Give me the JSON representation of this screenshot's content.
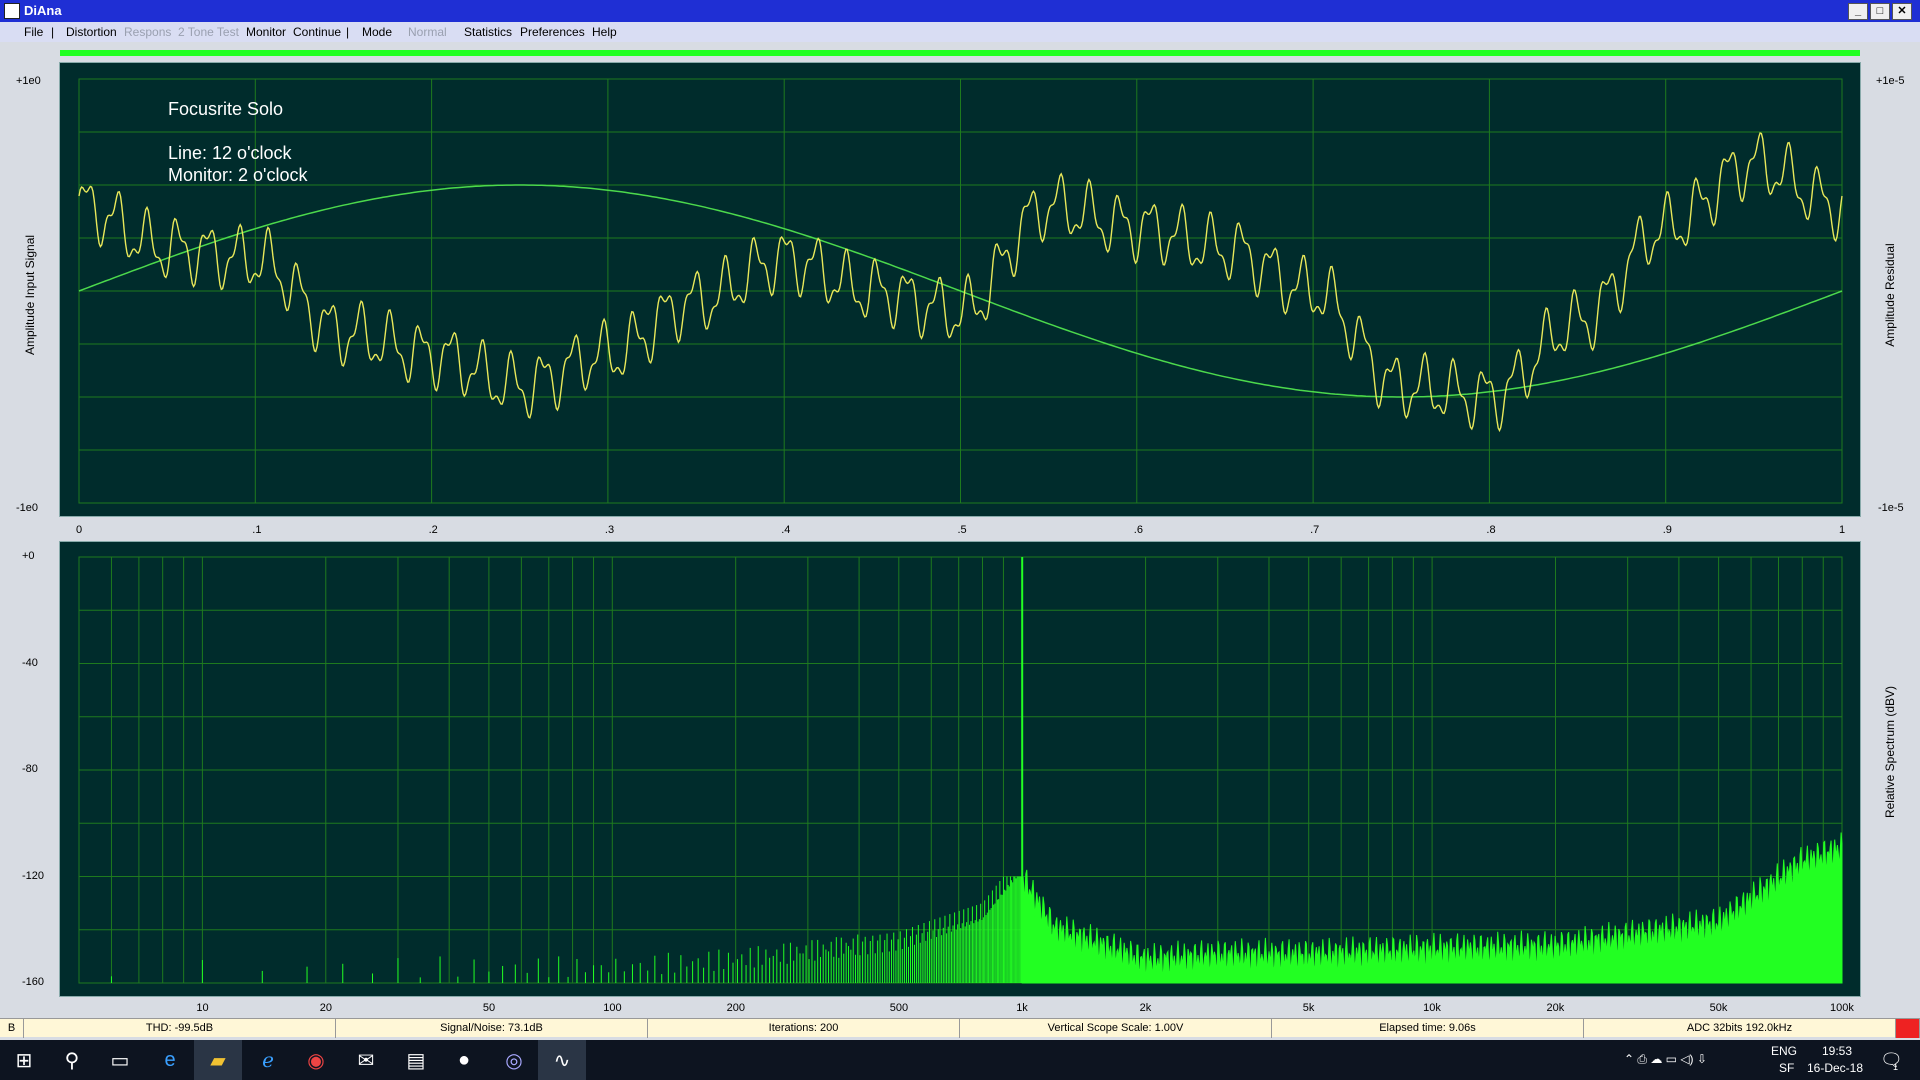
{
  "window": {
    "title": "DiAna"
  },
  "menu": {
    "file": "File",
    "sep1": "|",
    "distortion": "Distortion",
    "respons": "Respons",
    "two_tone": "2 Tone Test",
    "monitor": "Monitor",
    "continue": "Continue",
    "sep2": "|",
    "mode": "Mode",
    "normal": "Normal",
    "statistics": "Statistics",
    "preferences": "Preferences",
    "help": "Help"
  },
  "scope": {
    "left_axis_top": "+1e0",
    "left_axis_bottom": "-1e0",
    "right_axis_top": "+1e-5",
    "right_axis_bottom": "-1e-5",
    "left_label": "Amplitude Input Signal",
    "right_label": "Amplitude Residual",
    "note_title": "Focusrite Solo",
    "note_line": "Line: 12 o'clock",
    "note_monitor": "Monitor: 2 o'clock",
    "x_ticks": [
      "0",
      ".1",
      ".2",
      ".3",
      ".4",
      ".5",
      ".6",
      ".7",
      ".8",
      ".9",
      "1"
    ]
  },
  "spectrum": {
    "y_ticks": [
      "+0",
      "-40",
      "-80",
      "-120",
      "-160"
    ],
    "right_label": "Relative Spectrum (dBV)",
    "x_ticks": [
      "10",
      "20",
      "50",
      "100",
      "200",
      "500",
      "1k",
      "2k",
      "5k",
      "10k",
      "20k",
      "50k",
      "100k"
    ]
  },
  "status": {
    "b": "B",
    "thd": "THD:  -99.5dB",
    "snr": "Signal/Noise:  73.1dB",
    "iterations": "Iterations: 200",
    "vscale": "Vertical Scope Scale: 1.00V",
    "elapsed": "Elapsed time: 9.06s",
    "adc": "ADC 32bits 192.0kHz"
  },
  "taskbar": {
    "lang": "ENG",
    "layout": "SF",
    "time": "19:53",
    "date": "16-Dec-18",
    "notifications": "1"
  },
  "colors": {
    "plot_bg": "#002c2c",
    "grid": "#1e7a1e",
    "trace_yellow": "#e8e85a",
    "trace_green": "#4cd94c",
    "spectrum_fill": "#22ff22"
  },
  "chart_data": [
    {
      "type": "line",
      "series": [
        {
          "x": [
            0,
            0.25,
            0.5,
            0.75,
            1
          ],
          "values": [
            0,
            0.5,
            0,
            -0.5,
            0
          ]
        },
        {
          "x": [
            0,
            0.05,
            0.1,
            0.15,
            0.2,
            0.25,
            0.3,
            0.35,
            0.4,
            0.45,
            0.5,
            0.55,
            0.6,
            0.65,
            0.7,
            0.75,
            0.8,
            0.85,
            0.9,
            0.95,
            1
          ],
          "values": [
            0.4,
            0.2,
            0.15,
            -0.2,
            -0.3,
            -0.45,
            -0.3,
            -0.05,
            0.15,
            0.0,
            -0.1,
            0.4,
            0.3,
            0.2,
            0.0,
            -0.45,
            -0.5,
            -0.15,
            0.3,
            0.6,
            0.4
          ]
        }
      ],
      "ylim": [
        -1,
        1
      ],
      "xlim": [
        0,
        1
      ],
      "grid": true
    },
    {
      "type": "area",
      "x": [
        10,
        20,
        50,
        100,
        200,
        500,
        800,
        1000,
        1200,
        2000,
        3000,
        5000,
        10000,
        20000,
        50000,
        80000,
        100000
      ],
      "values": [
        -160,
        -160,
        -160,
        -160,
        -157,
        -150,
        -140,
        -121,
        -140,
        -152,
        -150,
        -150,
        -148,
        -147,
        -138,
        -115,
        -110
      ],
      "peak_x": 1000,
      "peak_value": 0,
      "ylim": [
        -160,
        0
      ],
      "xscale": "log",
      "grid": true
    }
  ]
}
